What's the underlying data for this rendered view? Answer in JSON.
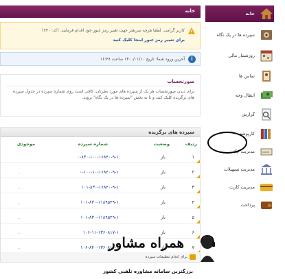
{
  "topbar": {
    "title": "خانه"
  },
  "alert": {
    "message": "کاربر گرامی، لطفا هرچه سریعتر جهت تغییر رمز عبور خود اقدام فرمایید. (کد: ۷۳۰)",
    "link": "برای تغییر رمز عبور اینجا کلیک کنید"
  },
  "info": {
    "text": "آخرین ورود شما: تاریخ ۱۴۰۰/۰۱/۱۰ ساعت ۱۶:۳۸"
  },
  "statement": {
    "title": "صورتحساب",
    "body": "برای دیدن صورتحساب هر یک از سپرده های مورد نظرتان، کافی است روی شماره سپرده در جدول سپرده های برگزیده کلیک کنید و یا به بخش \"سپرده ها در یک نگاه\" بروید."
  },
  "deposits": {
    "title": "سپرده های برگزیده",
    "columns": {
      "index": "ردیف",
      "status": "وضعیت",
      "number": "شماره سپرده",
      "balance": "موجودی"
    },
    "rows": [
      {
        "index": "۱",
        "status": "باز",
        "number": "۰-۸۳۰-۱۰۰-۱۶۸۴۰-۹-۱",
        "balance": ""
      },
      {
        "index": "۲",
        "status": "باز",
        "number": "۰-۱۰۰-۱۰-۱۶۸۴۰-۹-۱",
        "balance": "."
      },
      {
        "index": "۳",
        "status": "باز",
        "number": "۱۰۱-۸۳۰-۱۶۸۴۰-۹-۱",
        "balance": "."
      },
      {
        "index": "۴",
        "status": "باز",
        "number": "۱۰۱-۸۳۰-۱۱۸۹۵۴۹-۱",
        "balance": "."
      },
      {
        "index": "۵",
        "status": "باز",
        "number": "۱۰۱-۸۳۰-۱۱۸۹۵۴۹-۱",
        "balance": "."
      },
      {
        "index": "۶",
        "status": "باز",
        "number": "۱۰۶-۱۱-۱۳۶۰۸۱۷-۱",
        "balance": "."
      },
      {
        "index": "۷",
        "status": "باز",
        "number": "۱۰۶-۸۴۰-۱۳۶۰۸۱۷-۱",
        "balance": "."
      }
    ],
    "footer": "برای انجام تنظیمات سپرده"
  },
  "sidebar": {
    "items": [
      {
        "label": "خانه",
        "icon": "home-icon"
      },
      {
        "label": "سپرده ها در یک نگاه",
        "icon": "safe-icon"
      },
      {
        "label": "روزشمار مالی",
        "icon": "calendar-icon"
      },
      {
        "label": "تماس ها",
        "icon": "contacts-icon"
      },
      {
        "label": "انتقال وجه",
        "icon": "transfer-icon"
      },
      {
        "label": "گزارش",
        "icon": "report-icon"
      },
      {
        "label": "کارپوشه",
        "icon": "folders-icon"
      },
      {
        "label": "مدیریت چک",
        "icon": "cheque-icon"
      },
      {
        "label": "مدیریت تسهیلات",
        "icon": "building-icon"
      },
      {
        "label": "مدیریت کارت",
        "icon": "card-icon"
      },
      {
        "label": "پرداخت",
        "icon": "wallet-icon"
      }
    ]
  },
  "brand": {
    "name": "همراه مشاور",
    "tagline": "بزرگترین سامانه مشاوره تلفنی کشور"
  },
  "colors": {
    "accent": "#7a1f5c",
    "link": "#1a4fa0",
    "warn": "#e8a200"
  }
}
